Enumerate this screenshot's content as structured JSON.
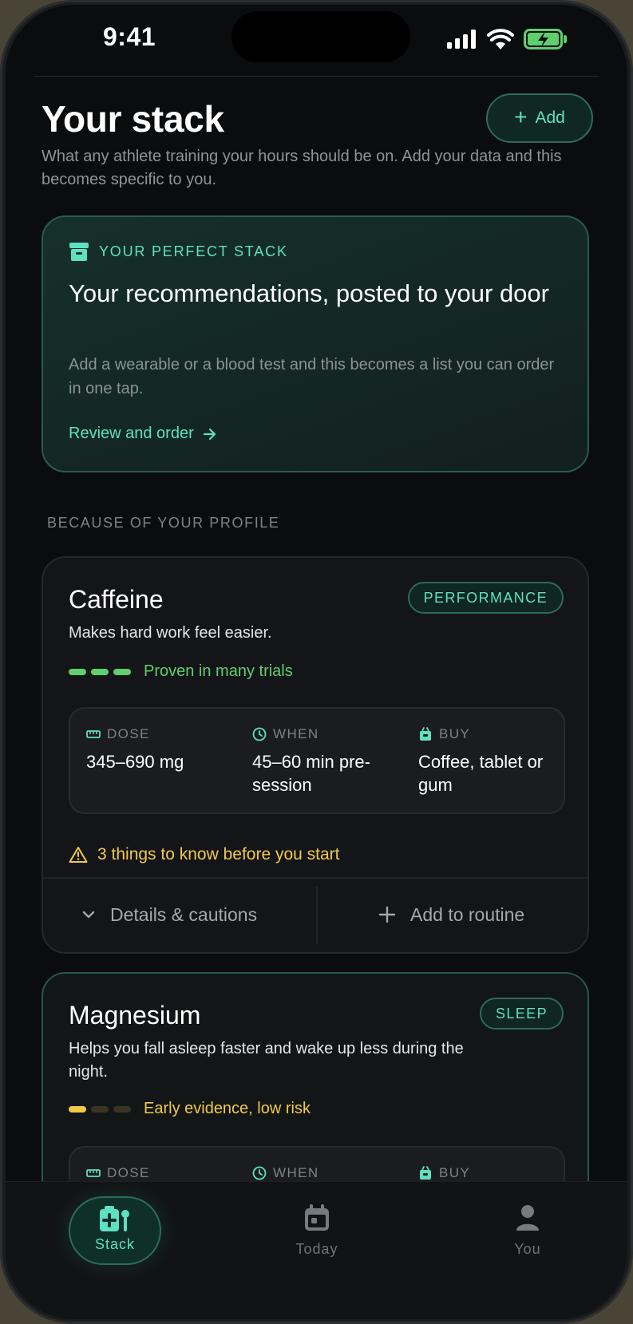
{
  "status_bar": {
    "time": "9:41"
  },
  "header": {
    "title": "Your stack",
    "add_label": "Add",
    "subtitle": "What any athlete training your hours should be on. Add your data and this becomes specific to you."
  },
  "promo": {
    "tag": "YOUR PERFECT STACK",
    "headline": "Your recommendations, posted to your door",
    "description": "Add a wearable or a blood test and this becomes a list you can order in one tap.",
    "cta": "Review and order"
  },
  "section_label": "BECAUSE OF YOUR PROFILE",
  "supplements": [
    {
      "name": "Caffeine",
      "category": "PERFORMANCE",
      "blurb": "Makes hard work feel easier.",
      "evidence": "Proven in many trials",
      "evidence_level": 3,
      "evidence_color": "#5fcf6e",
      "dose_label": "DOSE",
      "dose": "345–690 mg",
      "when_label": "WHEN",
      "when": "45–60 min pre-session",
      "buy_label": "BUY",
      "buy": "Coffee, tablet or gum",
      "warning": "3 things to know before you start",
      "details_label": "Details & cautions",
      "routine_label": "Add to routine"
    },
    {
      "name": "Magnesium",
      "category": "SLEEP",
      "blurb": "Helps you fall asleep faster and wake up less during the night.",
      "evidence": "Early evidence, low risk",
      "evidence_level": 1,
      "evidence_color": "#f1c94a",
      "dose_label": "DOSE",
      "when_label": "WHEN",
      "buy_label": "BUY"
    }
  ],
  "tabs": [
    {
      "label": "Stack",
      "icon": "medical-kit-icon",
      "active": true
    },
    {
      "label": "Today",
      "icon": "calendar-icon",
      "active": false
    },
    {
      "label": "You",
      "icon": "person-icon",
      "active": false
    }
  ],
  "colors": {
    "accent": "#5fe0c0",
    "warning": "#f1c94a",
    "proven": "#5fcf6e",
    "background": "#0b0c0e"
  }
}
